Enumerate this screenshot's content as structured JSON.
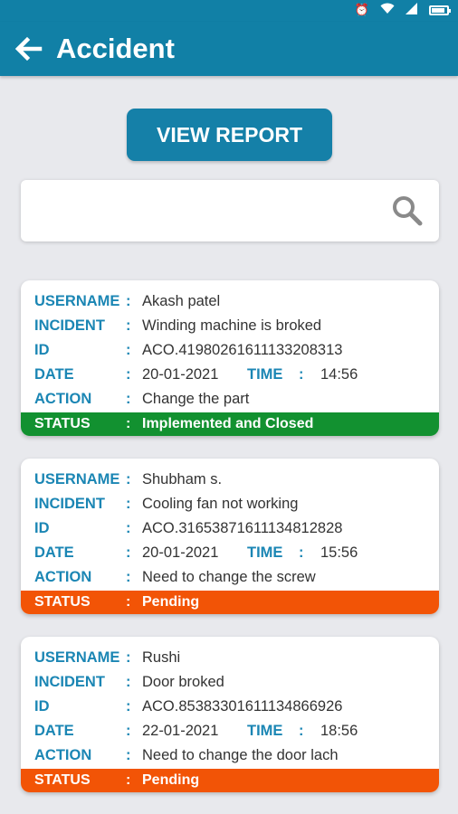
{
  "header": {
    "title": "Accident"
  },
  "actions": {
    "view_report_label": "VIEW REPORT"
  },
  "search": {
    "placeholder": "",
    "value": ""
  },
  "labels": {
    "username": "USERNAME",
    "incident": "INCIDENT",
    "id": "ID",
    "date": "DATE",
    "time": "TIME",
    "action": "ACTION",
    "status": "STATUS",
    "colon": ":"
  },
  "colors": {
    "primary": "#1180a6",
    "implemented": "#129130",
    "pending": "#f25406"
  },
  "records": [
    {
      "username": "Akash patel",
      "incident": "Winding machine is broked",
      "id": "ACO.41980261611133208313",
      "date": "20-01-2021",
      "time": "14:56",
      "action": "Change the part",
      "status": "Implemented and Closed",
      "status_color": "#129130"
    },
    {
      "username": "Shubham s.",
      "incident": "Cooling fan not working",
      "id": "ACO.31653871611134812828",
      "date": "20-01-2021",
      "time": "15:56",
      "action": "Need to change the screw",
      "status": "Pending",
      "status_color": "#f25406"
    },
    {
      "username": "Rushi",
      "incident": "Door broked",
      "id": "ACO.85383301611134866926",
      "date": "22-01-2021",
      "time": "18:56",
      "action": "Need to change the door lach",
      "status": "Pending",
      "status_color": "#f25406"
    }
  ]
}
